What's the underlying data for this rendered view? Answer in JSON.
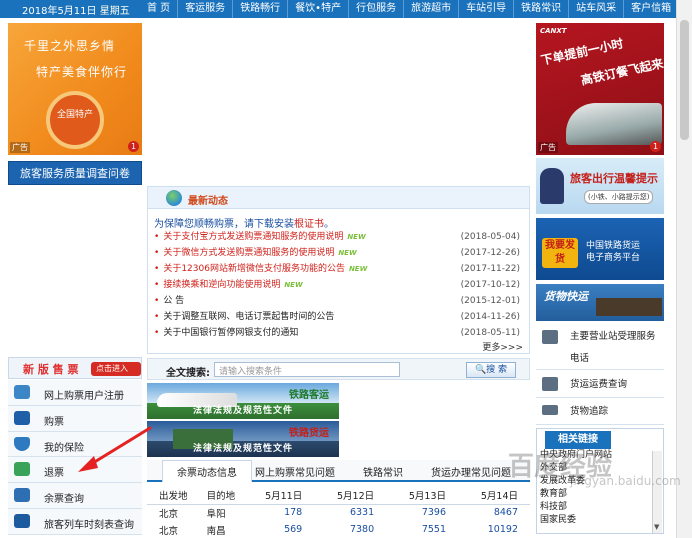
{
  "topbar": {
    "date": "2018年5月11日",
    "weekday": "星期五",
    "nav": [
      "首 页",
      "客运服务",
      "铁路畅行",
      "餐饮•特产",
      "行包服务",
      "旅游超市",
      "车站引导",
      "铁路常识",
      "站车风采",
      "客户信箱"
    ]
  },
  "left_ad": {
    "line1": "千里之外思乡情",
    "line2": "特产美食伴你行",
    "badge_text": "全国特产",
    "ad_label": "广告",
    "ad_count": "1"
  },
  "survey_button": "旅客服务质量调查问卷",
  "new_ticket": {
    "label": "新 版 售 票",
    "enter": "点击进入>>"
  },
  "left_menu": [
    {
      "icon": "user-register-icon",
      "label": "网上购票用户注册"
    },
    {
      "icon": "ticket-icon",
      "label": "购票"
    },
    {
      "icon": "shield-icon",
      "label": "我的保险"
    },
    {
      "icon": "refund-icon",
      "label": "退票"
    },
    {
      "icon": "balance-query-icon",
      "label": "余票查询"
    },
    {
      "icon": "train-timetable-icon",
      "label": "旅客列车时刻表查询"
    }
  ],
  "news": {
    "title": "最新动态",
    "tip_prefix": "为保障您顺畅购票，请下载安装",
    "tip_link": "根证书",
    "tip_suffix": "。",
    "new_tag": "NEW",
    "items": [
      {
        "text": "关于支付宝方式发送购票通知服务的使用说明",
        "date": "(2018-05-04)",
        "red": true,
        "new": true
      },
      {
        "text": "关于微信方式发送购票通知服务的使用说明",
        "date": "(2017-12-26)",
        "red": true,
        "new": true
      },
      {
        "text": "关于12306网站新增微信支付服务功能的公告",
        "date": "(2017-11-22)",
        "red": true,
        "new": true
      },
      {
        "text": "接续换乘和逆向功能使用说明",
        "date": "(2017-10-12)",
        "red": true,
        "new": true
      },
      {
        "text": "公 告",
        "date": "(2015-12-01)",
        "red": false,
        "new": false
      },
      {
        "text": "关于调整互联网、电话订票起售时间的公告",
        "date": "(2014-11-26)",
        "red": false,
        "new": false
      },
      {
        "text": "关于中国银行暂停网银支付的通知",
        "date": "(2018-05-11)",
        "red": false,
        "new": false
      }
    ],
    "more": "更多>>>"
  },
  "search": {
    "label": "全文搜索:",
    "placeholder": "请输入搜索条件",
    "button": "搜 索"
  },
  "rail_banners": [
    {
      "caption": "铁路客运",
      "subtitle": "法律法规及规范性文件"
    },
    {
      "caption": "铁路货运",
      "subtitle": "法律法规及规范性文件"
    }
  ],
  "tabs": [
    "余票动态信息",
    "网上购票常见问题",
    "铁路常识",
    "货运办理常见问题"
  ],
  "fare_table": {
    "headers": [
      "出发地",
      "目的地",
      "5月11日",
      "5月12日",
      "5月13日",
      "5月14日"
    ],
    "rows": [
      [
        "北京",
        "阜阳",
        "178",
        "6331",
        "7396",
        "8467"
      ],
      [
        "北京",
        "南昌",
        "569",
        "7380",
        "7551",
        "10192"
      ]
    ]
  },
  "right_ad": {
    "logo": "CANXT",
    "line1": "下单提前一小时",
    "line2": "高铁订餐飞起来",
    "ad_label": "广告",
    "ad_count": "1"
  },
  "right_banners": {
    "warning": "旅客出行温馨提示",
    "warning_sub": "(小铁、小路提示您)",
    "cargo_badge": "我要发货",
    "cargo_text1": "中国铁路货运",
    "cargo_text2": "电子商务平台",
    "express": "货物快运"
  },
  "right_services": [
    {
      "icon": "phone-service-icon",
      "label": "主要营业站受理服务电话"
    },
    {
      "icon": "freight-fee-icon",
      "label": "货运运费查询"
    },
    {
      "icon": "truck-icon",
      "label": "货物追踪"
    }
  ],
  "links": {
    "title": "相关链接",
    "items": [
      "中央政府门户网站",
      "外交部",
      "发展改革委",
      "教育部",
      "科技部",
      "国家民委"
    ]
  },
  "watermark": {
    "line1": "百度经验",
    "line2": "jingyan.baidu.com"
  },
  "colors": {
    "topbar": "#1a72bc",
    "accent_red": "#d0201a",
    "link_blue": "#1a4fa0"
  }
}
